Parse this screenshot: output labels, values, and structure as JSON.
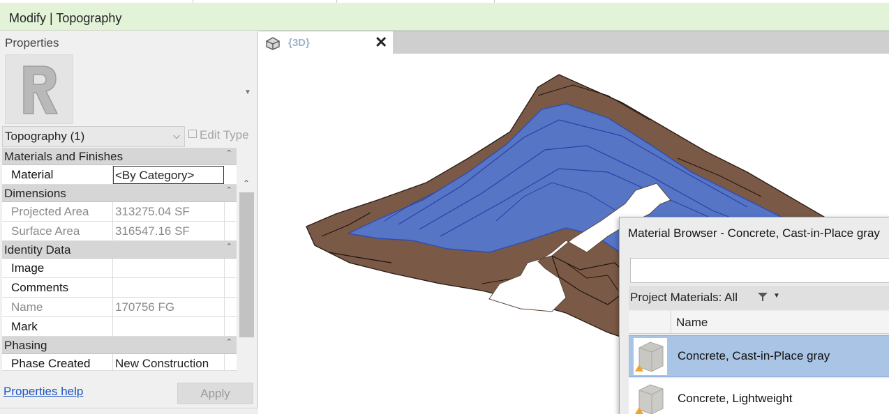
{
  "ribbon": {
    "title": "Modify | Topography"
  },
  "properties": {
    "title": "Properties",
    "type_selector": "Topography (1)",
    "edit_type": "Edit Type",
    "groups": {
      "materials": {
        "label": "Materials and Finishes",
        "material_label": "Material",
        "material_value": "<By Category>"
      },
      "dimensions": {
        "label": "Dimensions",
        "projected_area_label": "Projected Area",
        "projected_area_value": "313275.04 SF",
        "surface_area_label": "Surface Area",
        "surface_area_value": "316547.16 SF"
      },
      "identity": {
        "label": "Identity Data",
        "image_label": "Image",
        "image_value": "",
        "comments_label": "Comments",
        "comments_value": "",
        "name_label": "Name",
        "name_value": "170756 FG",
        "mark_label": "Mark",
        "mark_value": ""
      },
      "phasing": {
        "label": "Phasing",
        "phase_created_label": "Phase Created",
        "phase_created_value": "New Construction"
      }
    },
    "help_link": "Properties help",
    "apply": "Apply"
  },
  "view_tab": {
    "label": "{3D}",
    "icon": "house-3d-icon"
  },
  "colors": {
    "ribbon_bg": "#e3f3d8",
    "terrain": "#7a5a47",
    "water": "#5577cc",
    "selection": "#a9c4e4",
    "link": "#1a55c2"
  },
  "material_browser": {
    "title": "Material Browser - Concrete, Cast-in-Place gray",
    "search_value": "",
    "filter_label": "Project Materials: All",
    "column_name": "Name",
    "materials": [
      {
        "name": "Concrete, Cast-in-Place gray",
        "selected": true
      },
      {
        "name": "Concrete, Lightweight",
        "selected": false
      }
    ]
  }
}
